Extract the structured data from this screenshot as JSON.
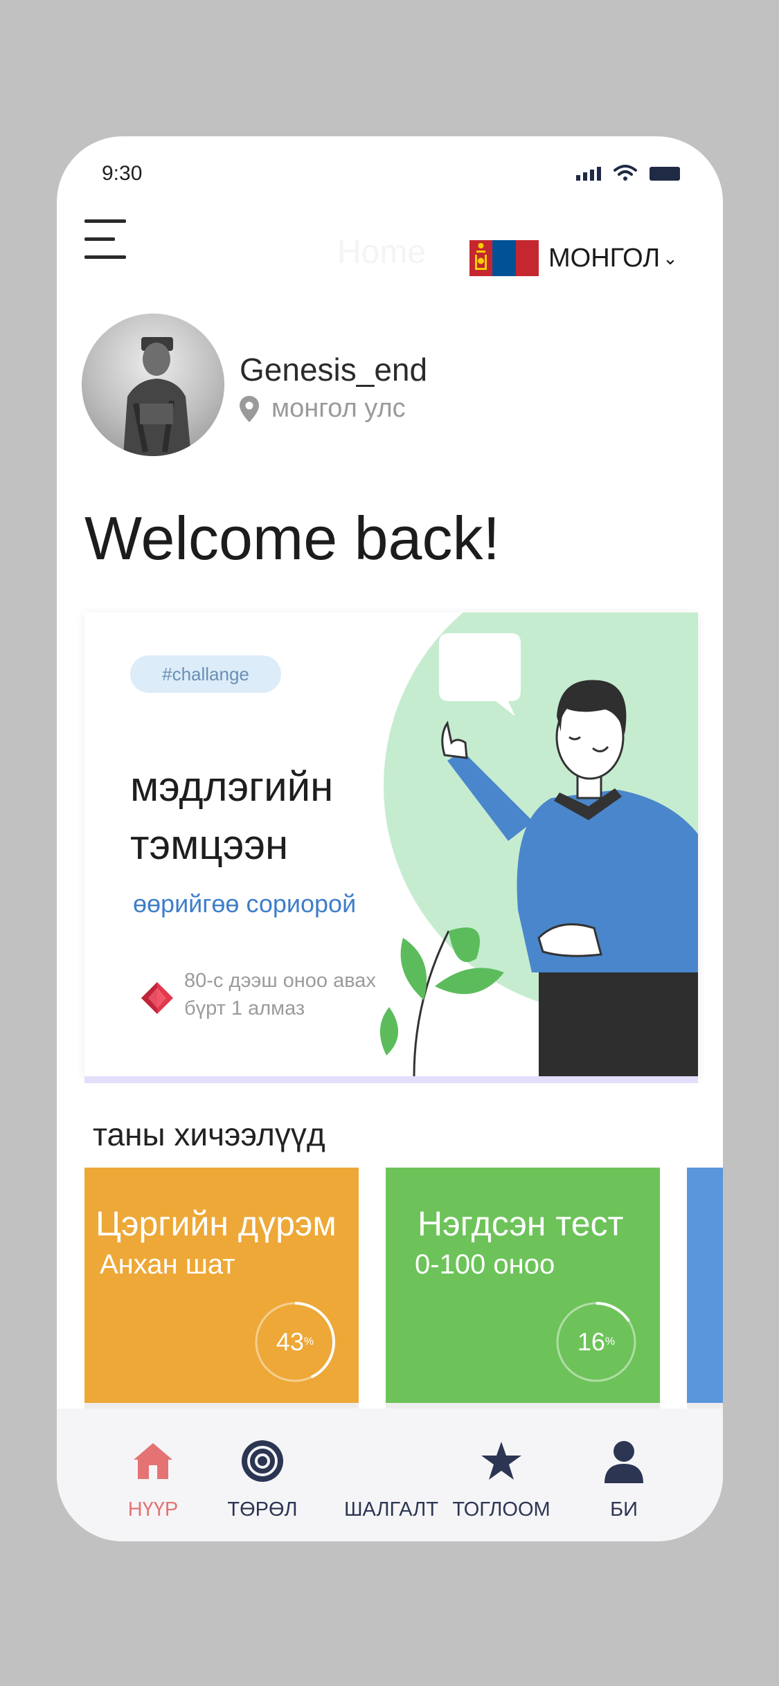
{
  "status_bar": {
    "time": "9:30"
  },
  "header": {
    "title": "Home",
    "language": {
      "label": "МОНГОЛ",
      "flag_colors": [
        "#c4272f",
        "#015197",
        "#c4272f"
      ],
      "emblem_color": "#f9cf02"
    }
  },
  "profile": {
    "username": "Genesis_end",
    "location": "монгол улс"
  },
  "welcome": "Welcome back!",
  "challenge_card": {
    "tag": "#challange",
    "title_line1": "мэдлэгийн",
    "title_line2": "тэмцээн",
    "subtitle": "өөрийгөө сориорой",
    "note_line1": "80-с дээш оноо авах",
    "note_line2": "бүрт 1 алмаз",
    "accent_color": "#3e7ec9",
    "illustration_bg": "#c6ecd0"
  },
  "lessons": {
    "section_title": "таны хичээлүүд",
    "items": [
      {
        "title": "Цэргийн дүрэм",
        "subtitle": "Анхан шат",
        "progress": 43,
        "progress_label": "43",
        "unit": "%",
        "color": "#eda838"
      },
      {
        "title": "Нэгдсэн тест",
        "subtitle": "0-100 оноо",
        "progress": 16,
        "progress_label": "16",
        "unit": "%",
        "color": "#6dc35a"
      },
      {
        "title": "",
        "subtitle": "",
        "color": "#5a96dc"
      }
    ]
  },
  "tab_bar": {
    "active_color": "#e57373",
    "inactive_color": "#2c3552",
    "items": [
      {
        "label": "НҮҮР",
        "icon": "home-icon",
        "active": true
      },
      {
        "label": "ТӨРӨЛ",
        "icon": "target-icon",
        "active": false
      },
      {
        "label": "ШАЛГАЛТ",
        "icon": "",
        "active": false
      },
      {
        "label": "ТОГЛООМ",
        "icon": "star-icon",
        "active": false
      },
      {
        "label": "БИ",
        "icon": "user-icon",
        "active": false
      }
    ]
  }
}
